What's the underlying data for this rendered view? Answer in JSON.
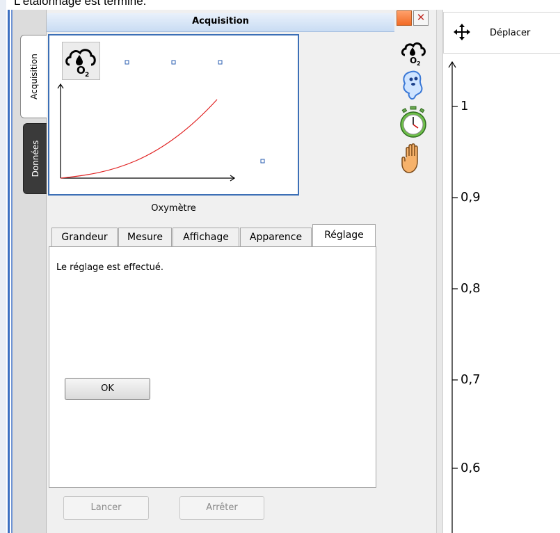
{
  "caption": "L'étalonnage est terminé.",
  "tabs_vertical": [
    {
      "label": "Acquisition"
    },
    {
      "label": "Données"
    }
  ],
  "panel": {
    "title": "Acquisition",
    "sensor_name": "Oxymètre",
    "sensor_icon": "o2-cloud-icon",
    "tabs": [
      {
        "label": "Grandeur"
      },
      {
        "label": "Mesure"
      },
      {
        "label": "Affichage"
      },
      {
        "label": "Apparence"
      },
      {
        "label": "Réglage"
      }
    ],
    "active_tab": "Réglage",
    "status_text": "Le réglage est effectué.",
    "ok_label": "OK",
    "lancer_label": "Lancer",
    "arreter_label": "Arrêter"
  },
  "side_icons": [
    "o2-cloud-icon",
    "ghost-icon",
    "stopwatch-icon",
    "hand-icon"
  ],
  "toolbar": {
    "deplacer_label": "Déplacer",
    "deplacer_icon": "move-arrows-icon"
  },
  "axis": {
    "ticks": [
      {
        "label": "1"
      },
      {
        "label": "0,9"
      },
      {
        "label": "0,8"
      },
      {
        "label": "0,7"
      },
      {
        "label": "0,6"
      }
    ]
  },
  "colors": {
    "accent_blue": "#3c6fb6",
    "close_red": "#c0302a",
    "orange": "#f26b25",
    "curve_red": "#e02020"
  }
}
